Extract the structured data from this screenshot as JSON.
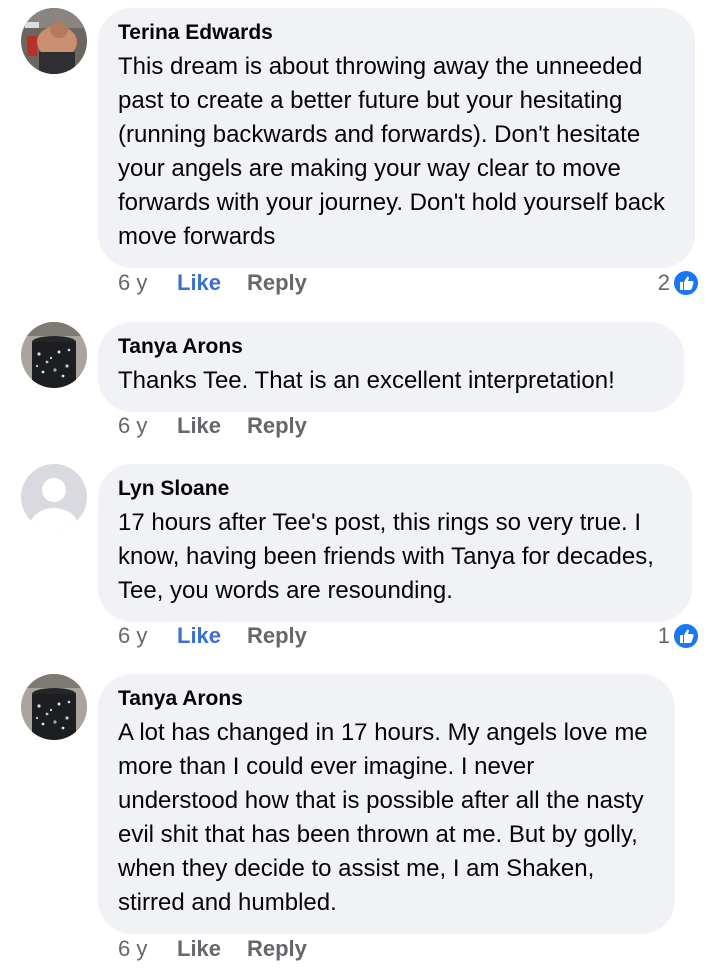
{
  "comments": [
    {
      "author": "Terina Edwards",
      "text": "This dream is about throwing away the unneeded past to create a better future but your hesitating (running backwards and forwards). Don't hesitate your angels are making your way clear to move forwards with your journey. Don't hold yourself back move forwards",
      "time": "6 y",
      "like_label": "Like",
      "reply_label": "Reply",
      "reaction_count": "2"
    },
    {
      "author": "Tanya Arons",
      "text": "Thanks Tee.  That is an excellent interpretation!",
      "time": "6 y",
      "like_label": "Like",
      "reply_label": "Reply"
    },
    {
      "author": "Lyn Sloane",
      "text": "17 hours after Tee's post, this rings so very true. I know, having been friends with Tanya for decades, Tee, you words are resounding.",
      "time": "6 y",
      "like_label": "Like",
      "reply_label": "Reply",
      "reaction_count": "1"
    },
    {
      "author": "Tanya Arons",
      "text": "A lot has changed in 17 hours.  My angels love me more than I could ever imagine.  I never understood how that is possible after all the nasty evil shit that has been thrown at me.  But by golly, when they decide to assist me, I am Shaken, stirred and humbled.",
      "time": "6 y",
      "like_label": "Like",
      "reply_label": "Reply"
    }
  ],
  "colors": {
    "bubble": "#f0f2f5",
    "like_active": "#3b6fd1",
    "reaction_blue": "#1877f2",
    "meta_gray": "#65676b"
  },
  "icons": {
    "reaction": "thumbs-up-icon",
    "default_avatar": "default-user-avatar-icon"
  }
}
